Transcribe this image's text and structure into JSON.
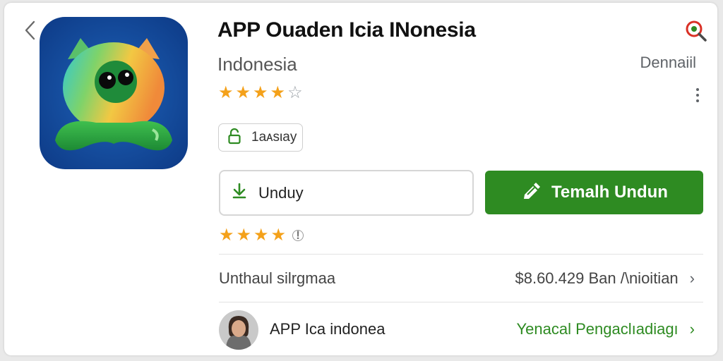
{
  "header": {
    "title": "APP Ouaden Icia INonesia",
    "subtitle": "Indonesia",
    "detail_link": "Dennaiil",
    "icons": {
      "back": "back-chevron-icon",
      "search": "search-icon",
      "more": "more-vert-icon"
    }
  },
  "app": {
    "icon": "app-logo",
    "rating_top": {
      "filled": 4,
      "total": 5
    },
    "chip_label": "1aᴀsιay",
    "chip_icon": "lock-icon"
  },
  "actions": {
    "download_label": "Unduy",
    "download_icon": "download-arrow-icon",
    "primary_label": "Temalh Undun",
    "primary_icon": "edit-tag-icon"
  },
  "rating_row": {
    "filled": 4,
    "total": 4,
    "badge_icon": "info-badge-icon"
  },
  "info_rows": [
    {
      "label": "Unthaul silrgmaa",
      "value": "$8.60.429 Ban /\\nioitian"
    },
    {
      "label": "APP Ica indonea",
      "value": "Yenacal Pengaclıadiagı"
    }
  ],
  "colors": {
    "primary_green": "#2e8b22",
    "star_orange": "#f4a11a",
    "link_green": "#2e8b22",
    "search_red": "#d93025"
  }
}
